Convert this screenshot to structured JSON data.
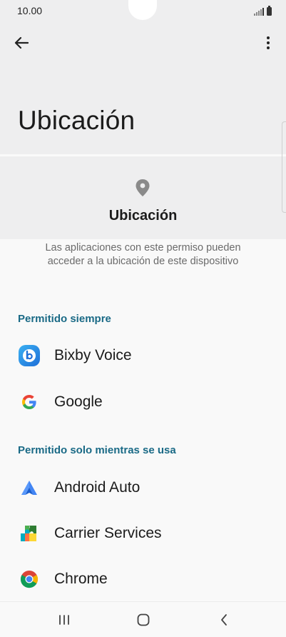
{
  "status_bar": {
    "time": "10.00"
  },
  "header": {
    "title": "Ubicación"
  },
  "permission": {
    "title": "Ubicación",
    "description": "Las aplicaciones con este permiso pueden acceder a la ubicación de este dispositivo"
  },
  "sections": [
    {
      "title": "Permitido siempre",
      "apps": [
        {
          "name": "Bixby Voice",
          "icon": "bixby-voice-icon"
        },
        {
          "name": "Google",
          "icon": "google-icon"
        }
      ]
    },
    {
      "title": "Permitido solo mientras se usa",
      "apps": [
        {
          "name": "Android Auto",
          "icon": "android-auto-icon"
        },
        {
          "name": "Carrier Services",
          "icon": "carrier-services-icon"
        },
        {
          "name": "Chrome",
          "icon": "chrome-icon"
        }
      ]
    }
  ],
  "colors": {
    "accent": "#1a6a86",
    "header_bg": "#eeeeef",
    "background": "#f9f9f9"
  }
}
